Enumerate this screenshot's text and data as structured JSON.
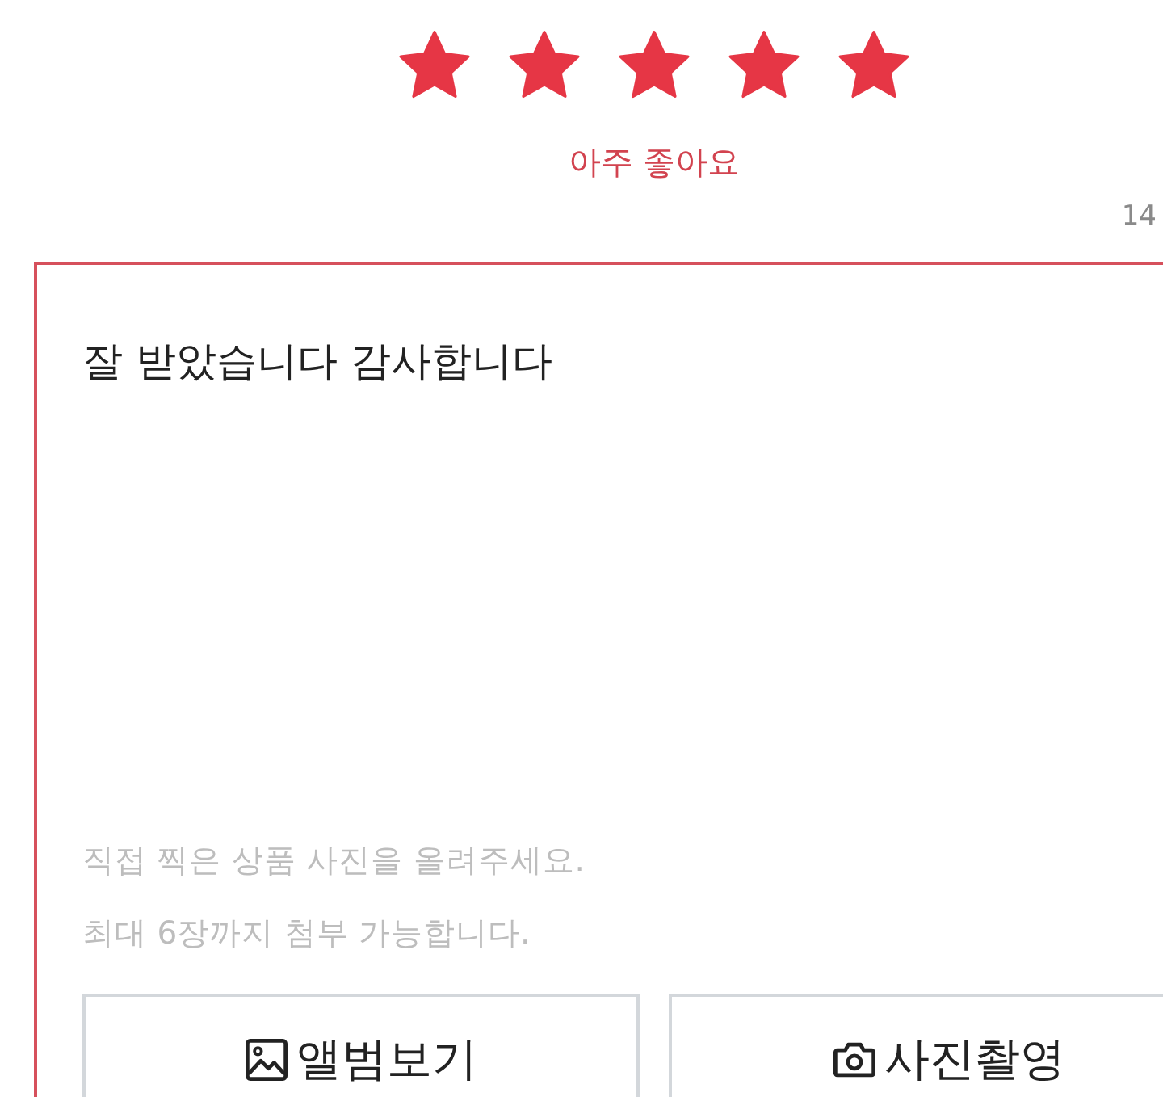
{
  "rating": {
    "stars": 5,
    "label": "아주 좋아요"
  },
  "review": {
    "char_count": "14",
    "text": "잘 받았습니다 감사합니다",
    "hints": [
      "직접 찍은 상품 사진을 올려주세요.",
      "최대 6장까지 첨부 가능합니다."
    ]
  },
  "photo_buttons": [
    {
      "kind": "album",
      "label": "앨범보기"
    },
    {
      "kind": "camera",
      "label": "사진촬영"
    }
  ]
}
